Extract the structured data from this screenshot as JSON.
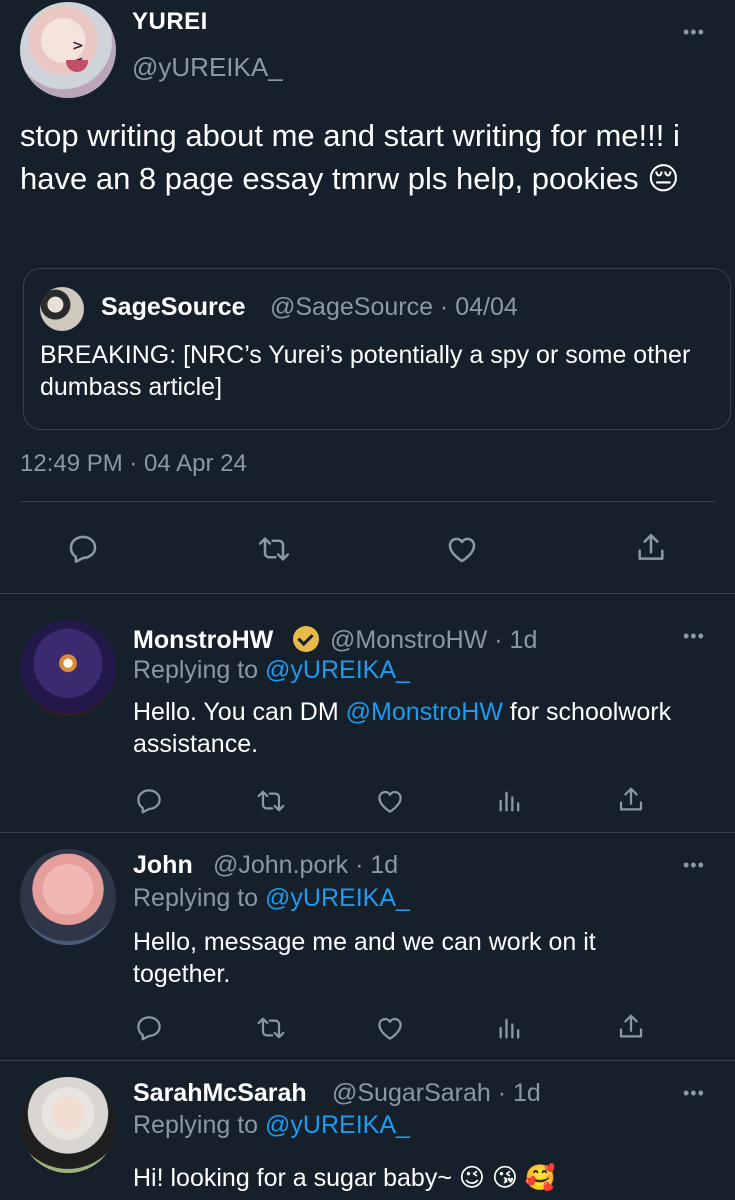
{
  "main_tweet": {
    "name": "YUREI",
    "handle": "@yUREIKA_",
    "text": "stop writing about me and start writing for me!!! i have an 8 page essay tmrw pls help, pookies 😔",
    "quote": {
      "name": "SageSource",
      "meta": "@SageSource · 04/04",
      "text": "BREAKING: [NRC’s Yurei’s potentially a spy or some other dumbass article]"
    },
    "timestamp": "12:49 PM · 04 Apr 24",
    "more": "•••"
  },
  "replies": [
    {
      "name": "MonstroHW",
      "meta": "@MonstroHW · 1d",
      "replying_prefix": "Replying to ",
      "replying_handle": "@yUREIKA_",
      "text_before": "Hello. You can DM ",
      "text_mention": "@MonstroHW",
      "text_after": " for schoolwork assistance.",
      "verified": true,
      "more": "•••"
    },
    {
      "name": "John",
      "meta": "@John.pork · 1d",
      "replying_prefix": "Replying to ",
      "replying_handle": "@yUREIKA_",
      "text": "Hello, message me and we can work on it together.",
      "more": "•••"
    },
    {
      "name": "SarahMcSarah",
      "meta": "@SugarSarah · 1d",
      "replying_prefix": "Replying to ",
      "replying_handle": "@yUREIKA_",
      "text": "Hi! looking for a sugar baby~ 😉 😘 🥰",
      "more": "•••"
    }
  ],
  "icons": {
    "reply": "reply-icon",
    "retweet": "retweet-icon",
    "like": "heart-icon",
    "analytics": "analytics-icon",
    "share": "share-icon"
  },
  "colors": {
    "background": "#15202b",
    "secondary_text": "#8b98a5",
    "link": "#1d9bf0",
    "divider": "#38444d",
    "verified": "#e9b949"
  }
}
